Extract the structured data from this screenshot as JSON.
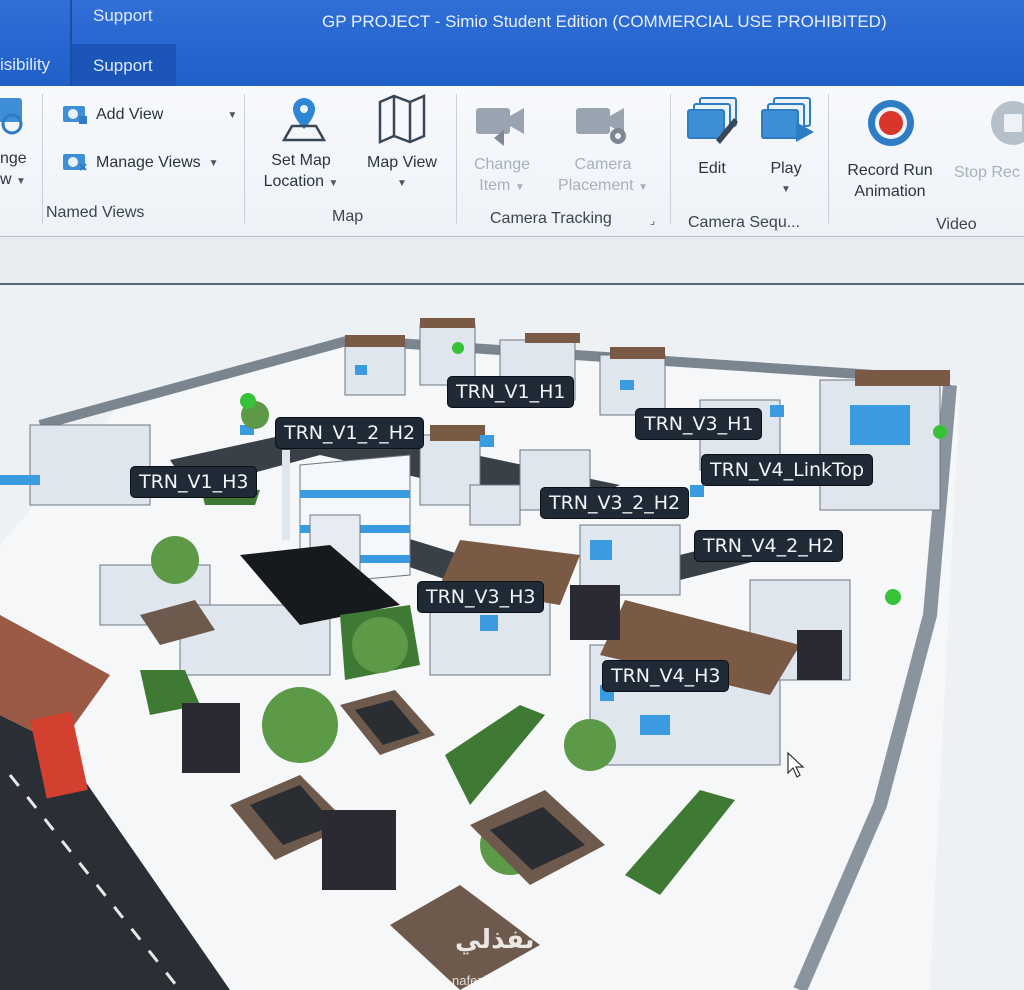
{
  "window": {
    "title": "GP PROJECT - Simio Student Edition (COMMERCIAL USE PROHIBITED)",
    "tabs": [
      "isibility",
      "Support",
      "Support"
    ]
  },
  "ribbon": {
    "named_views": {
      "label": "Named Views",
      "partial_btn_line1": "nge",
      "partial_btn_line2": "w",
      "add_view": "Add View",
      "manage_views": "Manage Views"
    },
    "map": {
      "label": "Map",
      "set_map_location_1": "Set Map",
      "set_map_location_2": "Location",
      "map_view": "Map View"
    },
    "camera_tracking": {
      "label": "Camera Tracking",
      "change_item_1": "Change",
      "change_item_2": "Item",
      "camera_placement_1": "Camera",
      "camera_placement_2": "Placement"
    },
    "camera_sequence": {
      "label": "Camera Sequ...",
      "edit": "Edit",
      "play": "Play"
    },
    "video": {
      "label": "Video",
      "record_1": "Record Run",
      "record_2": "Animation",
      "stop": "Stop Rec"
    }
  },
  "viewport": {
    "labels": [
      "TRN_V1_H1",
      "TRN_V1_2_H2",
      "TRN_V3_H1",
      "TRN_V1_H3",
      "TRN_V4_LinkTop",
      "TRN_V3_2_H2",
      "TRN_V4_2_H2",
      "TRN_V3_H3",
      "TRN_V4_H3"
    ],
    "watermark": "نفذلي",
    "watermark_sub": "nafezly.com"
  },
  "colors": {
    "titlebar": "#2565d0",
    "label_bg": "#1f2a36",
    "building_blue": "#3a9be0",
    "roof_brown": "#7a5a44",
    "record_red": "#d9352b"
  }
}
